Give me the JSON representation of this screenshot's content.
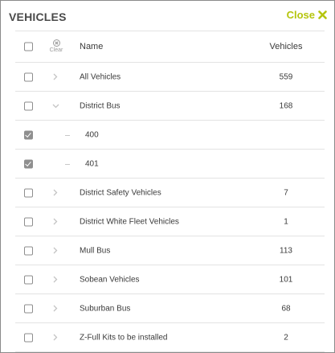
{
  "title": "VEHICLES",
  "close_label": "Close",
  "columns": {
    "name": "Name",
    "vehicles": "Vehicles",
    "clear": "Clear"
  },
  "colors": {
    "accent": "#b5c50e",
    "checked": "#8f8f8f"
  },
  "rows": [
    {
      "name": "All Vehicles",
      "count": "559",
      "checked": false,
      "chevron": "right"
    },
    {
      "name": "District Bus",
      "count": "168",
      "checked": false,
      "chevron": "down"
    },
    {
      "name": "400",
      "count": "",
      "checked": true,
      "child": true
    },
    {
      "name": "401",
      "count": "",
      "checked": true,
      "child": true
    },
    {
      "name": "District Safety Vehicles",
      "count": "7",
      "checked": false,
      "chevron": "right"
    },
    {
      "name": "District White Fleet Vehicles",
      "count": "1",
      "checked": false,
      "chevron": "right"
    },
    {
      "name": "Mull Bus",
      "count": "113",
      "checked": false,
      "chevron": "right"
    },
    {
      "name": "Sobean Vehicles",
      "count": "101",
      "checked": false,
      "chevron": "right"
    },
    {
      "name": "Suburban Bus",
      "count": "68",
      "checked": false,
      "chevron": "right"
    },
    {
      "name": "Z-Full Kits to be installed",
      "count": "2",
      "checked": false,
      "chevron": "right"
    }
  ]
}
